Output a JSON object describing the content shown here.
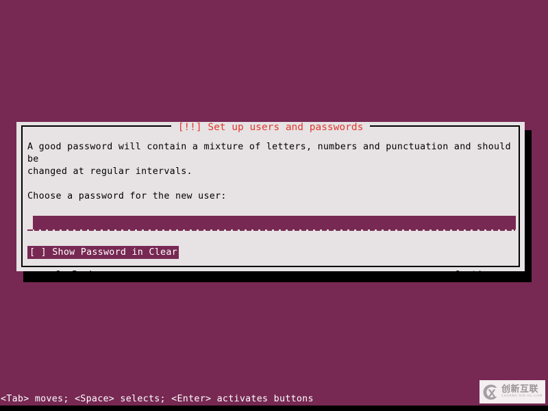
{
  "screen": {
    "background_color": "#772953",
    "dialog_bg_color": "#e7e2e4",
    "accent_color": "#772953",
    "title_color": "#df382c",
    "shadow_color": "#000000"
  },
  "dialog": {
    "title": "[!!] Set up users and passwords",
    "paragraphs": [
      "A good password will contain a mixture of letters, numbers and punctuation and should be\nchanged at regular intervals.",
      "Choose a password for the new user:"
    ],
    "password_input": {
      "value": "",
      "placeholder": ""
    },
    "checkbox": {
      "marker": "[ ]",
      "label": "Show Password in Clear",
      "checked": false,
      "full_text": "[ ] Show Password in Clear"
    },
    "buttons": {
      "back": "<Go Back>",
      "continue": "<Continue>"
    }
  },
  "status_bar": {
    "hint": "<Tab> moves; <Space> selects; <Enter> activates buttons"
  },
  "watermark": {
    "chinese": "创新互联",
    "pinyin": "CHUANG XIN HU LIAN"
  }
}
